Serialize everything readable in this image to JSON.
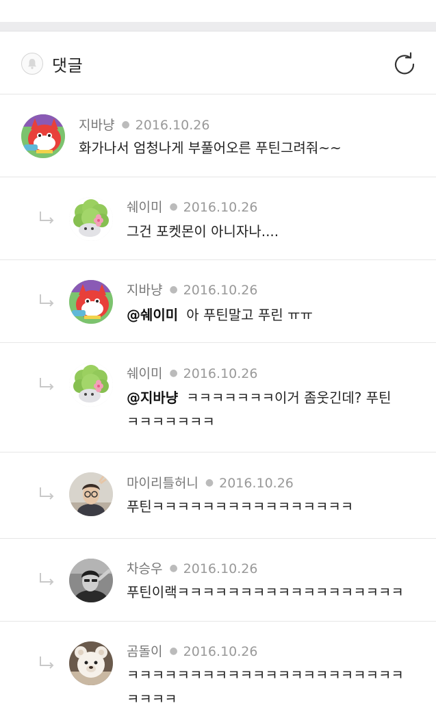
{
  "header": {
    "title": "댓글",
    "icons": {
      "left": "bell-icon",
      "right": "refresh-icon"
    }
  },
  "comments": [
    {
      "author": "지바냥",
      "date": "2016.10.26",
      "mention": "",
      "lines": [
        "화가나서 엄청나게 부풀어오른 푸틴그려줘~~"
      ],
      "avatar": "jibanyan-avatar"
    },
    {
      "author": "쉐이미",
      "date": "2016.10.26",
      "mention": "",
      "lines": [
        "그건 포켓몬이 아니자나...."
      ],
      "avatar": "shaymin-avatar"
    },
    {
      "author": "지바냥",
      "date": "2016.10.26",
      "mention": "@쉐이미",
      "lines": [
        "아 푸틴말고 푸린 ㅠㅠ"
      ],
      "avatar": "jibanyan-avatar"
    },
    {
      "author": "쉐이미",
      "date": "2016.10.26",
      "mention": "@지바냥",
      "lines": [
        "ㅋㅋㅋㅋㅋㅋㅋ이거 좀웃긴데? 푸틴",
        "ㅋㅋㅋㅋㅋㅋㅋ"
      ],
      "avatar": "shaymin-avatar"
    },
    {
      "author": "마이리틀허니",
      "date": "2016.10.26",
      "mention": "",
      "lines": [
        "푸틴ㅋㅋㅋㅋㅋㅋㅋㅋㅋㅋㅋㅋㅋㅋㅋㅋ"
      ],
      "avatar": "person-photo-avatar"
    },
    {
      "author": "차승우",
      "date": "2016.10.26",
      "mention": "",
      "lines": [
        "푸틴이랙ㅋㅋㅋㅋㅋㅋㅋㅋㅋㅋㅋㅋㅋㅋㅋㅋㅋㅋ"
      ],
      "avatar": "person-bw-avatar"
    },
    {
      "author": "곰돌이",
      "date": "2016.10.26",
      "mention": "",
      "lines": [
        "ㅋㅋㅋㅋㅋㅋㅋㅋㅋㅋㅋㅋㅋㅋㅋㅋㅋㅋㅋㅋㅋㅋ",
        "ㅋㅋㅋㅋ"
      ],
      "avatar": "teddy-bear-avatar"
    }
  ]
}
